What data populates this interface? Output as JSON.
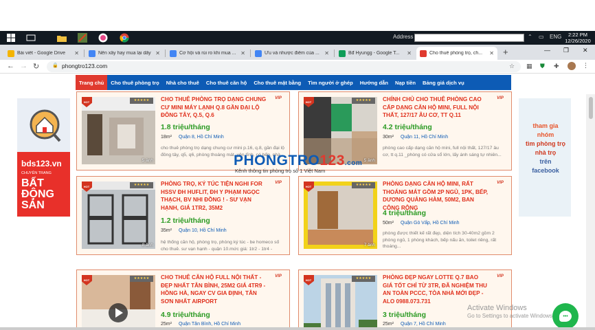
{
  "taskbar": {
    "address_label": "Address",
    "lang": "ENG",
    "time": "2:22 PM",
    "date": "12/26/2020"
  },
  "tabs": [
    {
      "title": "Bài viết - Google Drive",
      "fav_color": "#f4b400"
    },
    {
      "title": "Nên xây hay mua lại dãy ...",
      "fav_color": "#4285f4"
    },
    {
      "title": "Cơ hội và rủi ro khi mua ...",
      "fav_color": "#4285f4"
    },
    {
      "title": "Ưu và nhược điểm của ...",
      "fav_color": "#4285f4"
    },
    {
      "title": "Bđ Hyungg - Google T...",
      "fav_color": "#0f9d58"
    },
    {
      "title": "Cho thuê phòng trọ, ch...",
      "fav_color": "#e03a2f"
    }
  ],
  "browser": {
    "url": "phongtro123.com"
  },
  "nav": [
    "Trang chủ",
    "Cho thuê phòng trọ",
    "Nhà cho thuê",
    "Cho thuê căn hộ",
    "Cho thuê mặt bằng",
    "Tìm người ở ghép",
    "Hướng dẫn",
    "Nạp tiền",
    "Bảng giá dịch vụ"
  ],
  "banner_left": {
    "logo": "bds123.vn",
    "sub": "CHUYÊN TRANG",
    "big": "BẤT ĐỘNG SẢN"
  },
  "banner_right": {
    "line1": "tham gia",
    "line2": "nhóm",
    "line3": "tìm phòng trọ",
    "line4": "nhà trọ",
    "line5": "trên",
    "line6": "facebook"
  },
  "watermark": {
    "logo_a": "PHONGTRO",
    "logo_b": "123",
    "logo_c": ".com",
    "sub": "Kênh thông tin phòng trọ số 1 Việt Nam"
  },
  "listings": [
    {
      "title": "Cho thuê phòng trọ dạng chung cư mini máy lạnh Q.8 gần Đại lộ Đông Tây, Q.5, Q.6",
      "price": "1.8 triệu/tháng",
      "area": "18m²",
      "district": "Quận 8, Hồ Chí Minh",
      "desc": "cho thuê phòng trọ dạng chung cư mini p.16, q.8, gần đại lộ đông tây, q5, q6, phòng thoáng mát, yên tĩnh, có bếp, nhà...",
      "photos": "5 ảnh",
      "stars": "★★★★★",
      "vip": "VIP",
      "hot": "HOT"
    },
    {
      "title": "Chính Chủ Cho Thuê Phòng Cao Cấp Dạng Căn Hộ Mini, Full Nội Thất, 127/17 Âu Cơ, TT Q.11",
      "price": "4.2 triệu/tháng",
      "area": "30m²",
      "district": "Quận 11, Hồ Chí Minh",
      "desc": "phòng cao cấp dạng căn hộ mini, full nội thất, 127/17 âu cơ, tt q.11 _phòng có cửa sổ lớn, lấy ánh sáng tự nhiên...",
      "photos": "5 ảnh",
      "stars": "★★★★★",
      "vip": "VIP",
      "hot": "HOT"
    },
    {
      "title": "Phòng Trọ, Ký túc Tiện Nghi for HSSV ĐH HUFLIT, ĐH Y Phạm Ngọc Thạch, BV Nhi đồng ! - Sư Vạn Hạnh, Giá 1tr2, 35m2",
      "price": "1.2 triệu/tháng",
      "area": "35m²",
      "district": "Quận 10, Hồ Chí Minh",
      "desc": "hệ thống căn hộ, phòng trọ, phòng ký túc - be homeco số cho thuê. sư vạn hạnh - quận 10.mức giá: 1tr2 - 1tr4 -",
      "photos": "8 ảnh",
      "stars": "★★★★★",
      "vip": "VIP",
      "hot": "HOT"
    },
    {
      "title": "Phòng dạng căn hộ mini, rất thoáng mát gồm 2P ngủ, 1PK, Bếp, Dương Quảng Hàm, 50m2, ban công rộng",
      "price": "4 triệu/tháng",
      "area": "50m²",
      "district": "Quận Gò Vấp, Hồ Chí Minh",
      "desc": "phòng được thiết kế rất đẹp, diện tích 30-40m2 gồm 2 phòng ngủ, 1 phòng khách, bếp nấu ăn, toilet riêng, rất thoáng...",
      "photos": "7 ảnh",
      "stars": "★★★★★",
      "vip": "VIP",
      "hot": "HOT"
    },
    {
      "title": "Cho thuê căn hộ FULL NỘI THẤT - Đẹp nhất Tân Bình, 25m2 Giá 4tr9 - Hồng Hà, Ngay CV Gia Định, TÂN SƠN NHẤT Airport",
      "price": "4.9 triệu/tháng",
      "area": "25m²",
      "district": "Quận Tân Bình, Hồ Chí Minh",
      "desc": "",
      "photos": "",
      "stars": "★★★★★",
      "vip": "VIP",
      "hot": "HOT"
    },
    {
      "title": "Phòng đẹp ngay Lotte Q.7 bao giá tốt chỉ từ 3tr, đã nghiệm thu an toàn PCCC, tòa nhà mới đẹp - Alo 0988.073.731",
      "price": "3 triệu/tháng",
      "area": "25m²",
      "district": "Quận 7, Hồ Chí Minh",
      "desc": "",
      "photos": "",
      "stars": "★★★★★",
      "vip": "VIP",
      "hot": "HOT"
    }
  ],
  "activate": {
    "line1": "Activate Windows",
    "line2": "Go to Settings to activate Windows."
  }
}
